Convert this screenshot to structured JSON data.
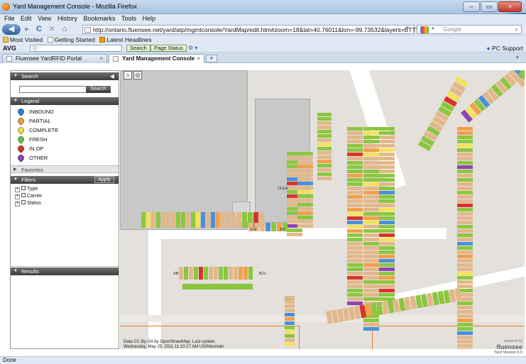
{
  "window": {
    "title": "Yard Management Console - Mozilla Firefox",
    "controls": [
      "–",
      "▭",
      "×"
    ]
  },
  "menu": [
    "File",
    "Edit",
    "View",
    "History",
    "Bookmarks",
    "Tools",
    "Help"
  ],
  "nav": {
    "url": "http://ontario.fluensee.net/yard/atp/mgmtconsole/YardMap/edit.htm#zoom=18&lat=40.76011&lon=-99.73532&layers=BTTTT",
    "search_placeholder": "Google",
    "star_icon": "star-icon"
  },
  "bookmarks": [
    "Most Visited",
    "Getting Started",
    "Latest Headlines"
  ],
  "avg": {
    "label": "AVG",
    "search_placeholder": "Q -",
    "search_button": "Search",
    "page_status": "Page Status",
    "pc_support": "PC Support"
  },
  "tabs": [
    {
      "label": "Fluensee YardRFID Portal",
      "active": false
    },
    {
      "label": "Yard Management Console",
      "active": true
    }
  ],
  "panel": {
    "search_header": "Search",
    "search_button": "Search",
    "legend_header": "Legend",
    "legend": [
      {
        "label": "INBOUND",
        "color": "#2f80d1"
      },
      {
        "label": "PARTIAL",
        "color": "#e8a13a"
      },
      {
        "label": "COMPLETE",
        "color": "#e8e04a"
      },
      {
        "label": "FRESH",
        "color": "#6cc04a"
      },
      {
        "label": "IN OP",
        "color": "#d9342b"
      },
      {
        "label": "OTHER",
        "color": "#8e44ad"
      }
    ],
    "favorites_header": "Favorites",
    "filters_header": "Filters",
    "apply_button": "Apply",
    "filters": [
      "Type",
      "Carrier",
      "Status"
    ],
    "results_header": "Results"
  },
  "map": {
    "labels": {
      "clea": "CLEA",
      "fw": "FW",
      "b7": "B7",
      "sb": "SB",
      "b21": "B21"
    },
    "attribution_line1": "Data CC-By-SA by OpenStreetMap. Last update:",
    "attribution_line2": "Wednesday, May 25, 2011 11:10:17 AM US/Mountain",
    "brand": "fluensee",
    "brand_powered": "powered by",
    "version": "Yard Version 5.0",
    "colors": {
      "tan": "#e2b88a",
      "green": "#8cc63f",
      "orange": "#f0a04b",
      "yellow": "#f2e35a",
      "blue": "#4a90d9",
      "red": "#d9342b",
      "purple": "#8e44ad"
    }
  },
  "status": "Done"
}
